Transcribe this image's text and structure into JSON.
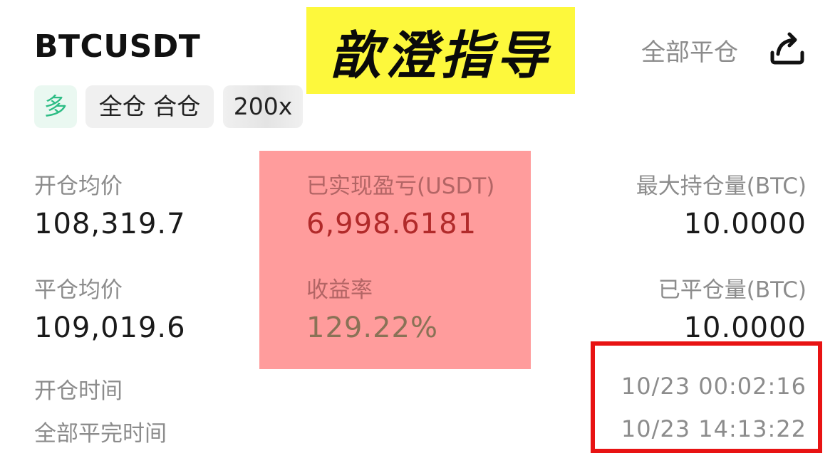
{
  "header": {
    "symbol": "BTCUSDT",
    "close_all_label": "全部平仓",
    "share_icon": "share-icon"
  },
  "tags": {
    "side": "多",
    "margin_mode": "全仓 合仓",
    "leverage": "200x"
  },
  "overlay": {
    "banner_text": "歆澄指导",
    "banner_color": "#fdf83c",
    "highlight_color": "#ff9c9c",
    "frame_color": "#e81313"
  },
  "stats": {
    "avg_open_price_label": "开仓均价",
    "avg_open_price": "108,319.7",
    "avg_close_price_label": "平仓均价",
    "avg_close_price": "109,019.6",
    "realized_pnl_label": "已实现盈亏(USDT)",
    "realized_pnl": "6,998.6181",
    "roi_label": "收益率",
    "roi": "129.22%",
    "max_position_label": "最大持仓量(BTC)",
    "max_position": "10.0000",
    "closed_amount_label": "已平仓量(BTC)",
    "closed_amount": "10.0000"
  },
  "times": {
    "open_time_label": "开仓时间",
    "open_time": "10/23 00:02:16",
    "close_time_label": "全部平完时间",
    "close_time": "10/23 14:13:22"
  },
  "colors": {
    "long_green": "#2dbd85",
    "tag_bg": "#f0f0f0",
    "muted_text": "#8c8c8c"
  }
}
